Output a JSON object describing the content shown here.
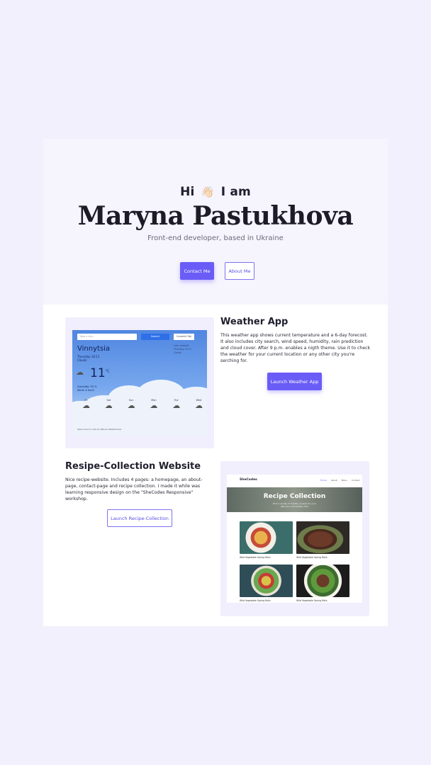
{
  "hero": {
    "greeting_pre": "Hi",
    "greeting_emoji": "👋🏻",
    "greeting_post": "I am",
    "name": "Maryna Pastukhova",
    "subtitle": "Front-end developer, based in Ukraine",
    "contact_label": "Contact Me",
    "about_label": "About Me"
  },
  "projects": [
    {
      "title": "Weather App",
      "description": "This weather app shows current temperature and a 6-day forecost. It also includes city search, wind speed, humidity, rain prediction and cloud cover. After 9 p.m. enables a nigth theme. Use it to check the weather for your current location or any other city you're serching for.",
      "button_label": "Launch Weather App"
    },
    {
      "title": "Resipe-Collection Website",
      "description": "Nice recipe-website. Includes 4 pages: a homepage, an about-page, contact-page and recipe collection. I made it while was learning responsive design on the \"SheCodes Responsive\" workshop.",
      "button_label": "Launch Recipe-Collection"
    }
  ],
  "weather_preview": {
    "search_placeholder": "Type a city...",
    "search_button": "Search",
    "current_button": "Current City",
    "city": "Vinnytsia",
    "date_line": "Thursday 10:11",
    "condition": "Clouds",
    "side_line1": "Last updated:",
    "side_line2": "Thursday 10:11",
    "side_line3": "Clouds",
    "temperature": "11",
    "unit": "°C",
    "humidity": "Humidity: 59 %",
    "wind": "Wind: 4 km/h",
    "days": [
      "Fri",
      "Sat",
      "Sun",
      "Mon",
      "Tue",
      "Wed"
    ],
    "footer": "Open-source code by Maryna Pastukhova"
  },
  "recipe_preview": {
    "logo": "SheCodes",
    "nav": [
      "Home",
      "About",
      "Menu",
      "Contact"
    ],
    "banner_title": "Recipe Collection",
    "banner_tagline1": "Find a variety of healthy recipes for your",
    "banner_tagline2": "delicious and healthy food",
    "items": [
      "Wild Vegetable Spring Rolls",
      "Wild Vegetable Spring Rolls",
      "Wild Vegetable Spring Rolls",
      "Wild Vegetable Spring Rolls"
    ]
  },
  "colors": {
    "page_bg": "#f3f0fd",
    "accent": "#6a5cf6",
    "text": "#1f1f2e"
  }
}
